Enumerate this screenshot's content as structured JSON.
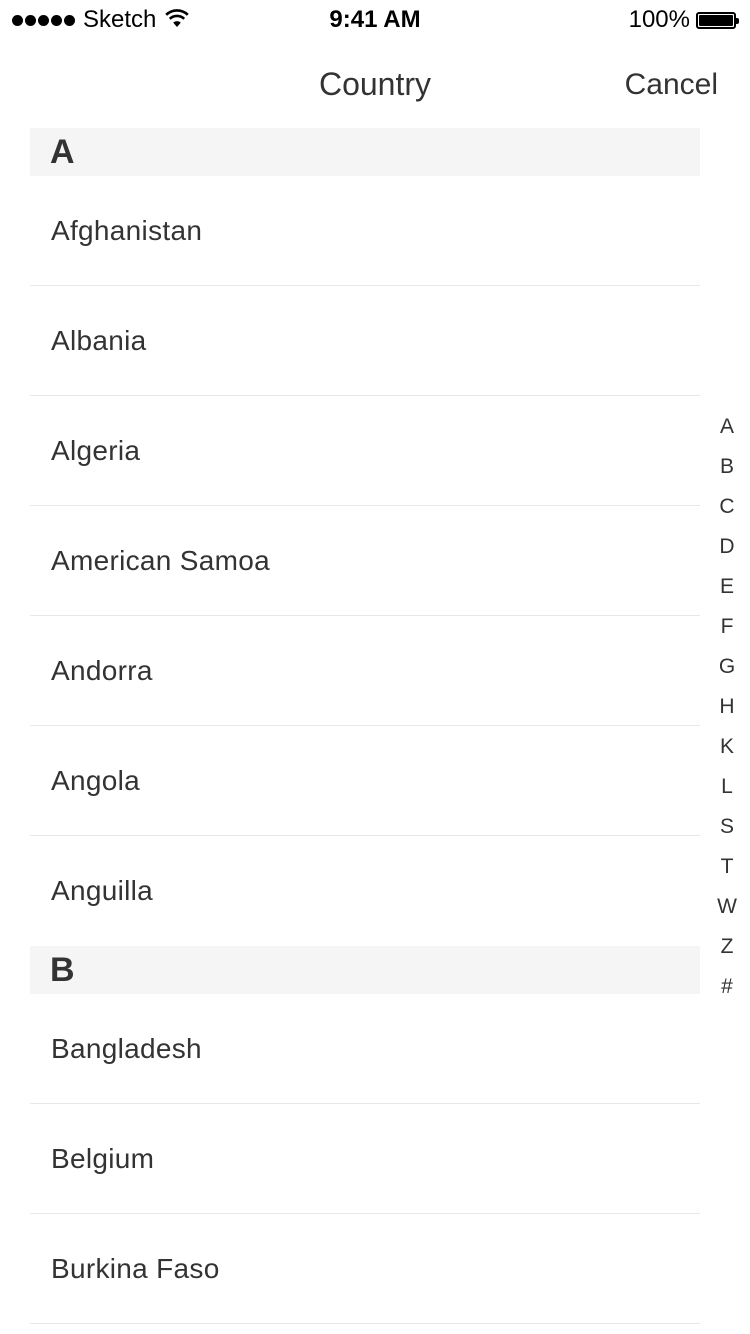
{
  "status_bar": {
    "carrier": "Sketch",
    "time": "9:41 AM",
    "battery": "100%",
    "signal_icon": "signal-dots-icon",
    "wifi_icon": "wifi-icon",
    "battery_icon": "battery-icon"
  },
  "nav": {
    "title": "Country",
    "cancel_label": "Cancel"
  },
  "sections": [
    {
      "letter": "A",
      "items": [
        "Afghanistan",
        "Albania",
        "Algeria",
        "American Samoa",
        "Andorra",
        "Angola",
        "Anguilla"
      ]
    },
    {
      "letter": "B",
      "items": [
        "Bangladesh",
        "Belgium",
        "Burkina Faso"
      ]
    }
  ],
  "index": [
    "A",
    "B",
    "C",
    "D",
    "E",
    "F",
    "G",
    "H",
    "K",
    "L",
    "S",
    "T",
    "W",
    "Z",
    "#"
  ],
  "colors": {
    "text": "#333333",
    "section_header_bg": "#f5f5f5",
    "separator": "#e8e8e8"
  }
}
